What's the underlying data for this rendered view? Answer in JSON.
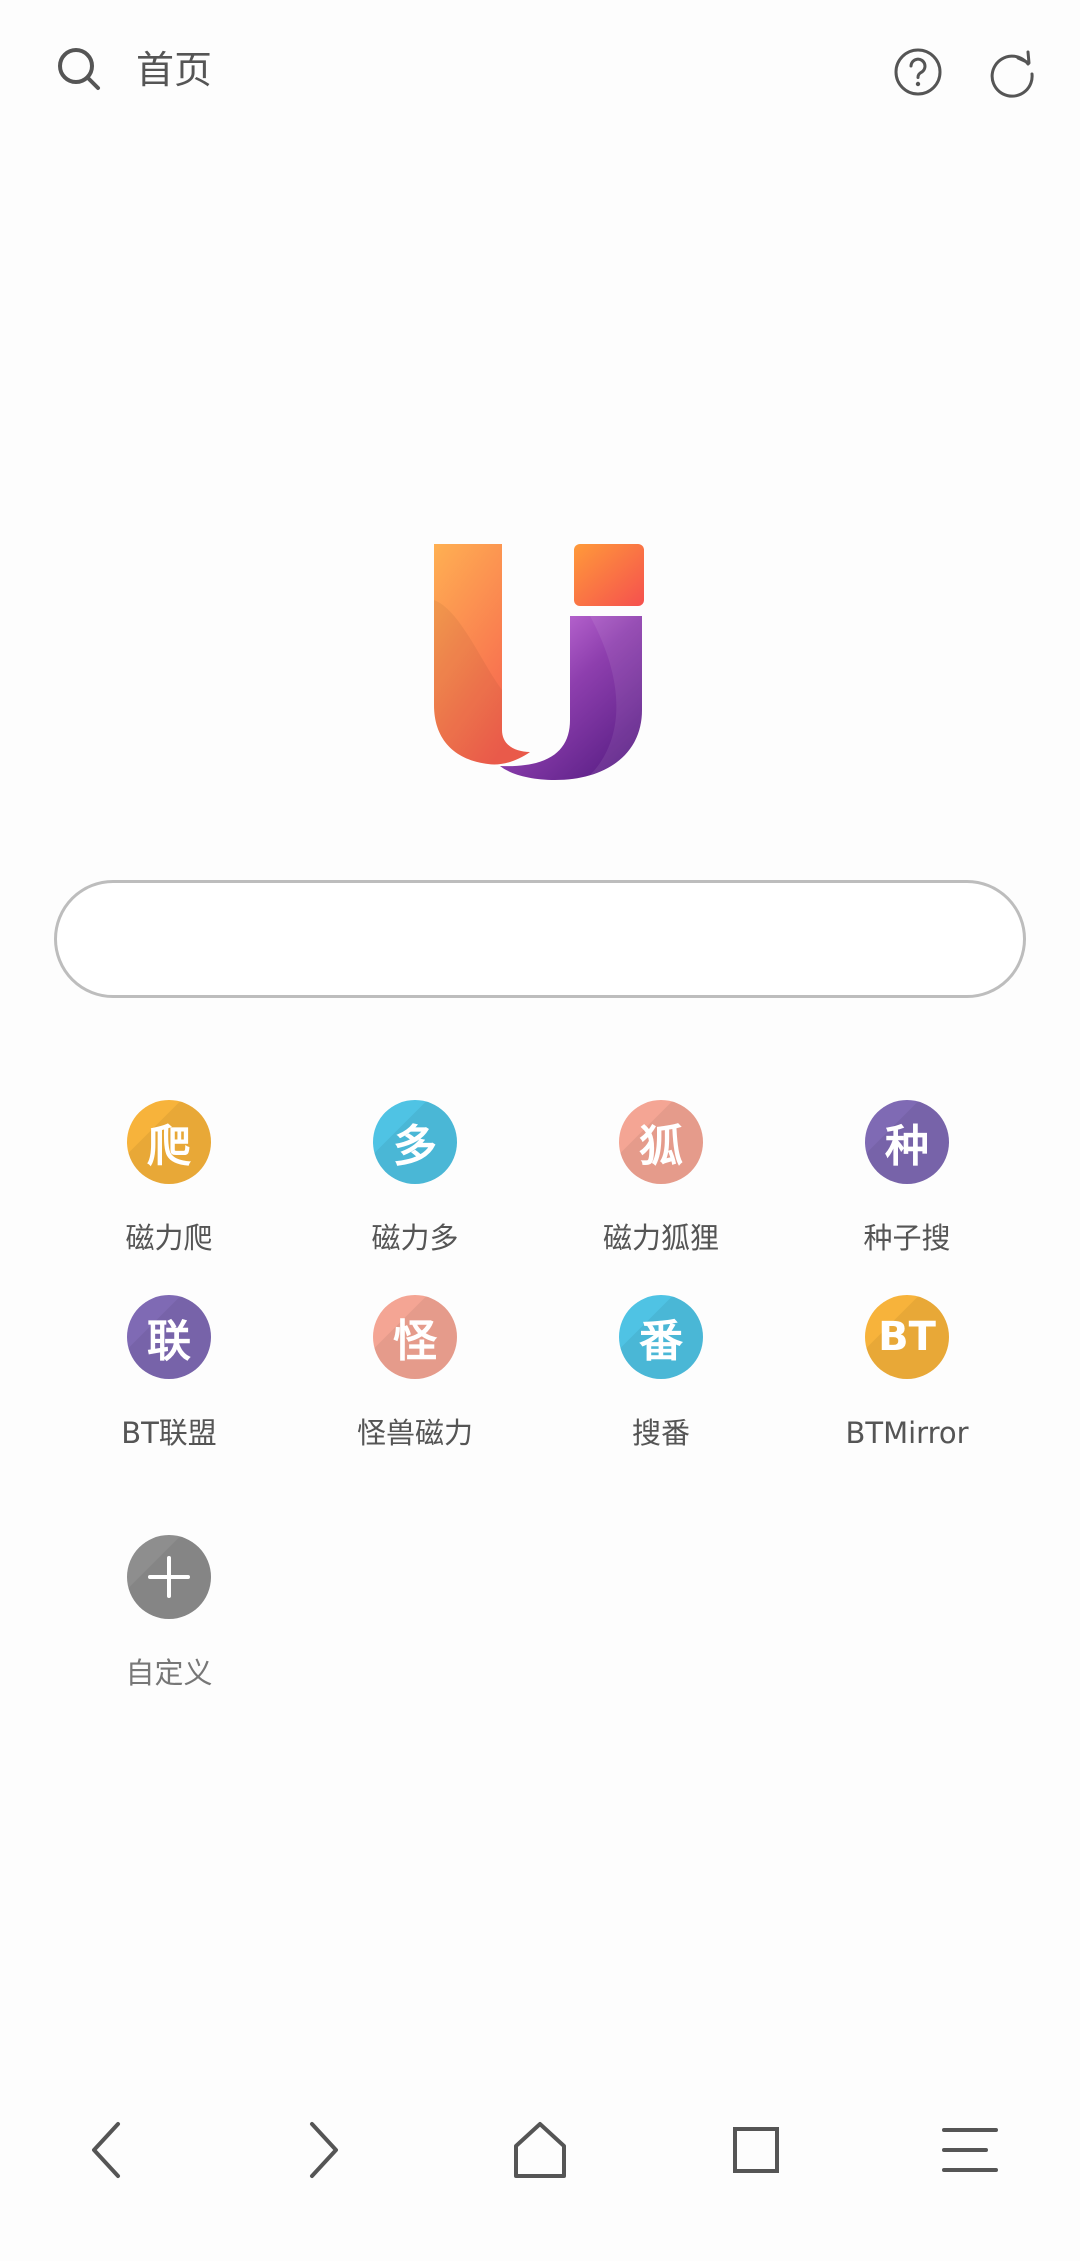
{
  "header": {
    "title": "首页",
    "icons": [
      "search-icon",
      "help-icon",
      "refresh-icon"
    ]
  },
  "search": {
    "value": "",
    "placeholder": ""
  },
  "sites": [
    {
      "label": "磁力爬",
      "glyph": "爬",
      "color": "#f7b33b"
    },
    {
      "label": "磁力多",
      "glyph": "多",
      "color": "#4fc3e4"
    },
    {
      "label": "磁力狐狸",
      "glyph": "狐",
      "color": "#f4a594"
    },
    {
      "label": "种子搜",
      "glyph": "种",
      "color": "#7f6ab4"
    },
    {
      "label": "BT联盟",
      "glyph": "联",
      "color": "#7f6ab4"
    },
    {
      "label": "怪兽磁力",
      "glyph": "怪",
      "color": "#f4a594"
    },
    {
      "label": "搜番",
      "glyph": "番",
      "color": "#4fc3e4"
    },
    {
      "label": "BTMirror",
      "glyph": "BT",
      "color": "#f7b33b"
    }
  ],
  "custom": {
    "label": "自定义",
    "glyph": "+",
    "color": "#8e8e8e"
  },
  "bottom_nav": [
    "back-icon",
    "forward-icon",
    "home-icon",
    "tabs-icon",
    "menu-icon"
  ]
}
